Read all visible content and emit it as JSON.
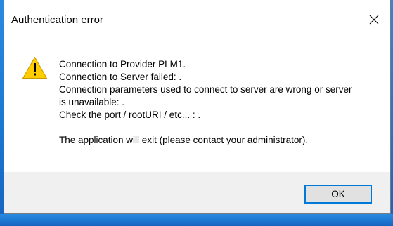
{
  "dialog": {
    "title": "Authentication error",
    "close_icon": "close-icon",
    "warning_icon": "warning-icon",
    "message_lines": [
      "Connection to Provider PLM1.",
      "Connection to Server failed: .",
      "Connection parameters used to connect to server are wrong or server",
      "is unavailable: .",
      "Check the port / rootURI / etc... : ."
    ],
    "exit_message": "The application will exit (please contact your administrator).",
    "ok_label": "OK"
  },
  "colors": {
    "accent": "#0078d7",
    "warning_fill": "#ffcc00",
    "desktop": "#1976d2"
  }
}
